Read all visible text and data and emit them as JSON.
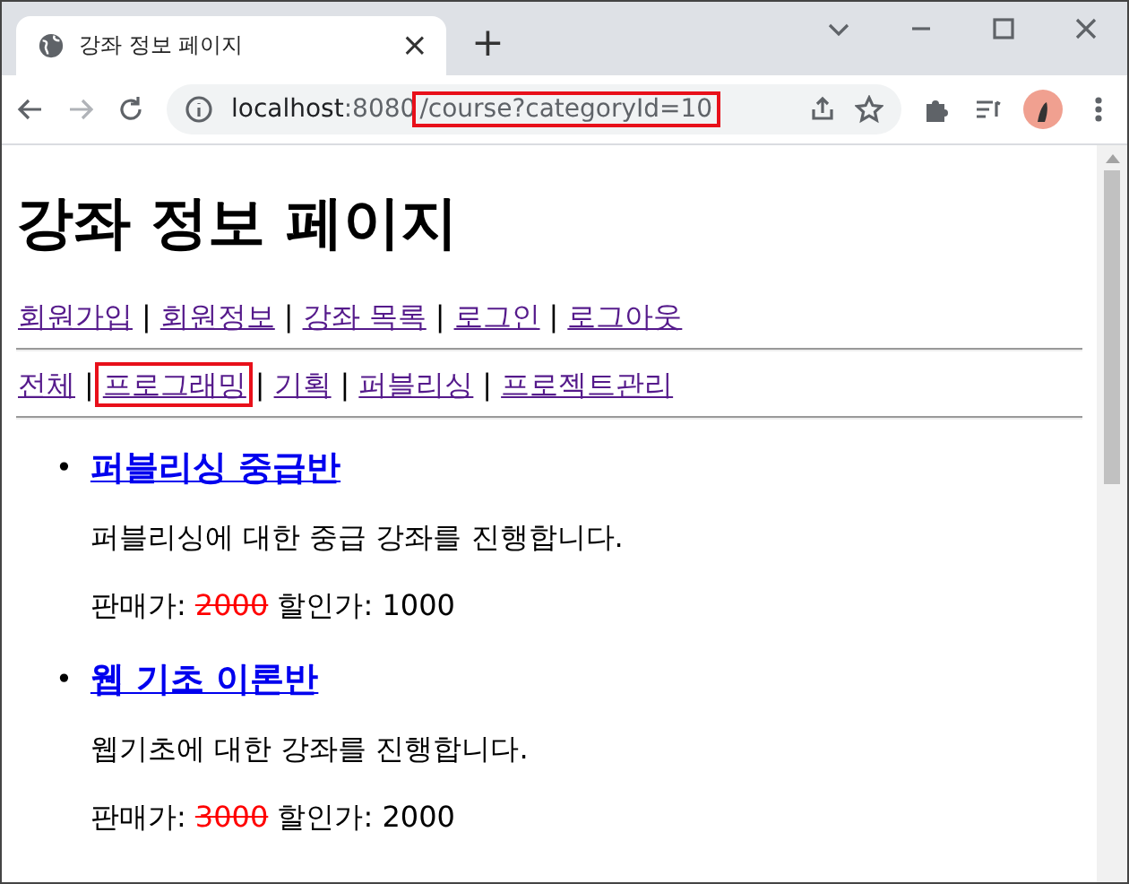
{
  "tab": {
    "title": "강좌 정보 페이지",
    "close": "×",
    "new_tab": "+"
  },
  "address_bar": {
    "host": "localhost",
    "port": ":8080",
    "path": "/course?categoryId=10",
    "path_highlighted": true
  },
  "page": {
    "heading": "강좌 정보 페이지",
    "top_nav": [
      {
        "label": "회원가입",
        "visited": true
      },
      {
        "label": "회원정보",
        "visited": true
      },
      {
        "label": "강좌 목록",
        "visited": true
      },
      {
        "label": "로그인",
        "visited": true
      },
      {
        "label": "로그아웃",
        "visited": true
      }
    ],
    "separator": "|",
    "bullet": "•",
    "categories": [
      {
        "label": "전체",
        "visited": true,
        "highlighted": false
      },
      {
        "label": "프로그래밍",
        "visited": true,
        "highlighted": true
      },
      {
        "label": "기획",
        "visited": true,
        "highlighted": false
      },
      {
        "label": "퍼블리싱",
        "visited": true,
        "highlighted": false
      },
      {
        "label": "프로젝트관리",
        "visited": true,
        "highlighted": false
      }
    ],
    "courses": [
      {
        "title": "퍼블리싱 중급반",
        "visited": false,
        "description": "퍼블리싱에 대한 중급 강좌를 진행합니다.",
        "price_label": "판매가:",
        "price": "2000",
        "discount_label": "할인가:",
        "discount_price": "1000"
      },
      {
        "title": "웹 기초 이론반",
        "visited": false,
        "description": "웹기초에 대한 강좌를 진행합니다.",
        "price_label": "판매가:",
        "price": "3000",
        "discount_label": "할인가:",
        "discount_price": "2000"
      }
    ]
  }
}
